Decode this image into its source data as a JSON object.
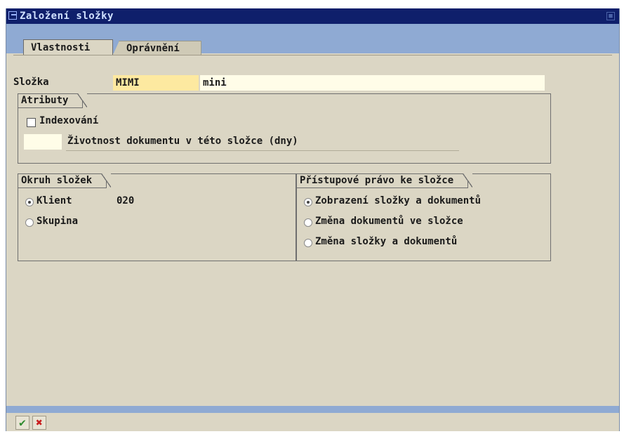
{
  "window": {
    "title": "Založení složky"
  },
  "tabs": [
    {
      "label": "Vlastnosti",
      "active": true
    },
    {
      "label": "Oprávnění",
      "active": false
    }
  ],
  "folder": {
    "label": "Složka",
    "code_value": "MIMI",
    "name_value": "mini"
  },
  "attributes": {
    "title": "Atributy",
    "indexing_label": "Indexování",
    "indexing_checked": false,
    "lifetime_value": "",
    "lifetime_label": "Životnost dokumentu v této složce (dny)"
  },
  "folder_scope": {
    "title": "Okruh složek",
    "options": [
      {
        "label": "Klient",
        "selected": true,
        "value": "020"
      },
      {
        "label": "Skupina",
        "selected": false
      }
    ]
  },
  "access_rights": {
    "title": "Přístupové právo ke složce",
    "options": [
      {
        "label": "Zobrazení složky a dokumentů",
        "selected": true
      },
      {
        "label": "Změna dokumentů ve složce",
        "selected": false
      },
      {
        "label": "Změna složky a dokumentů",
        "selected": false
      }
    ]
  },
  "buttons": {
    "confirm_icon": "checkmark-icon",
    "cancel_icon": "cancel-x-icon",
    "confirm_color": "#2e8b2e",
    "cancel_color": "#c81e1e"
  }
}
